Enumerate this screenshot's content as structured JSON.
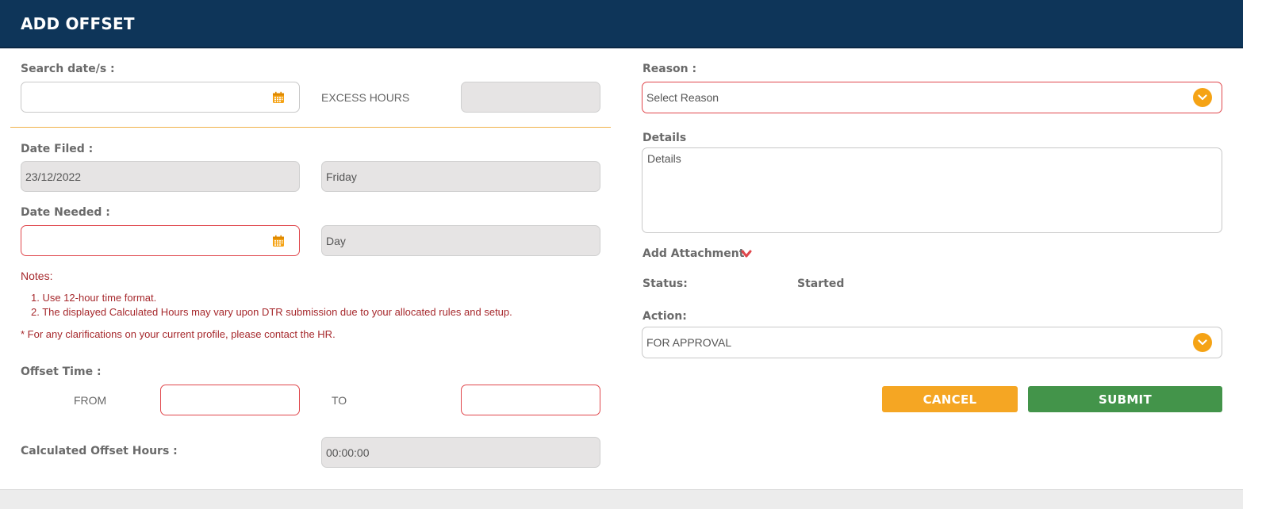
{
  "header": {
    "title": "ADD OFFSET"
  },
  "left": {
    "search_label": "Search date/s :",
    "search_value": "",
    "excess_hours_label": "EXCESS HOURS",
    "excess_hours_value": "",
    "date_filed_label": "Date Filed :",
    "date_filed_value": "23/12/2022",
    "date_filed_day": "Friday",
    "date_needed_label": "Date Needed :",
    "date_needed_value": "",
    "date_needed_day": "Day",
    "notes_title": "Notes:",
    "notes": [
      "1. Use 12-hour time format.",
      "2. The displayed Calculated Hours may vary upon DTR submission due to your allocated rules and setup."
    ],
    "notes_footer": "* For any clarifications on your current profile, please contact the HR.",
    "offset_time_label": "Offset Time :",
    "from_label": "FROM",
    "from_value": "",
    "to_label": "TO",
    "to_value": "",
    "calculated_label": "Calculated Offset Hours :",
    "calculated_value": "00:00:00"
  },
  "right": {
    "reason_label": "Reason :",
    "reason_value": "Select Reason",
    "details_label": "Details",
    "details_placeholder": "Details",
    "attachment_label": "Add Attachment",
    "status_label": "Status:",
    "status_value": "Started",
    "action_label": "Action:",
    "action_value": "FOR APPROVAL",
    "cancel_label": "CANCEL",
    "submit_label": "SUBMIT"
  },
  "icons": {
    "calendar": "calendar-icon",
    "chevron": "chevron-down-icon"
  },
  "colors": {
    "header_bg": "#0e3559",
    "accent_orange": "#f5a315",
    "error_red": "#e0474c",
    "submit_green": "#43944a",
    "notes_red": "#a6282c"
  }
}
